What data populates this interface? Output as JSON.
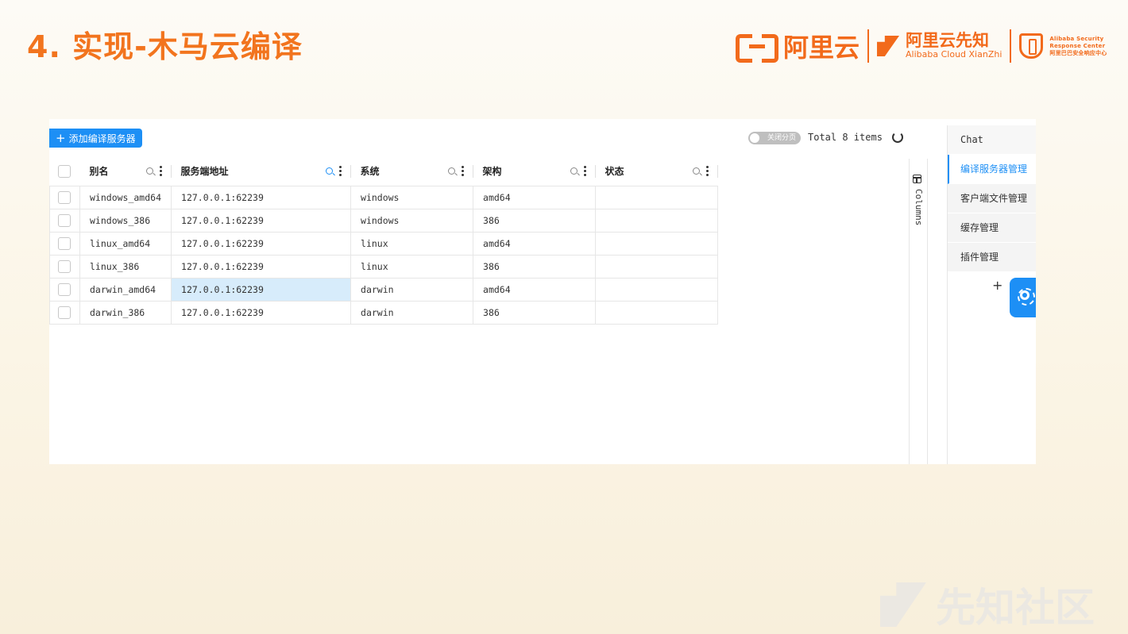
{
  "slide": {
    "title": "4. 实现-木马云编译"
  },
  "logos": {
    "aliyun": "阿里云",
    "xianzhi_cn": "阿里云先知",
    "xianzhi_en": "Alibaba Cloud XianZhi",
    "asrc_line1": "Alibaba Security",
    "asrc_line2": "Response Center",
    "asrc_line3": "阿里巴巴安全响应中心"
  },
  "toolbar": {
    "add_label": "添加编译服务器",
    "pager_toggle_label": "关闭分页",
    "total": "Total 8 items"
  },
  "table": {
    "headers": [
      "别名",
      "服务端地址",
      "系统",
      "架构",
      "状态"
    ],
    "rows": [
      [
        "windows_amd64",
        "127.0.0.1:62239",
        "windows",
        "amd64",
        ""
      ],
      [
        "windows_386",
        "127.0.0.1:62239",
        "windows",
        "386",
        ""
      ],
      [
        "linux_amd64",
        "127.0.0.1:62239",
        "linux",
        "amd64",
        ""
      ],
      [
        "linux_386",
        "127.0.0.1:62239",
        "linux",
        "386",
        ""
      ],
      [
        "darwin_amd64",
        "127.0.0.1:62239",
        "darwin",
        "amd64",
        ""
      ],
      [
        "darwin_386",
        "127.0.0.1:62239",
        "darwin",
        "386",
        ""
      ]
    ]
  },
  "columns_tab": {
    "label": "Columns"
  },
  "sidebar": {
    "items": [
      {
        "label": "Chat"
      },
      {
        "label": "编译服务器管理"
      },
      {
        "label": "客户端文件管理"
      },
      {
        "label": "缓存管理"
      },
      {
        "label": "插件管理"
      }
    ],
    "add": "+"
  },
  "watermark": {
    "text": "先知社区"
  },
  "colors": {
    "accent": "#f26a1b",
    "primary": "#1d8ff5",
    "selection": "#d7ecfb"
  }
}
